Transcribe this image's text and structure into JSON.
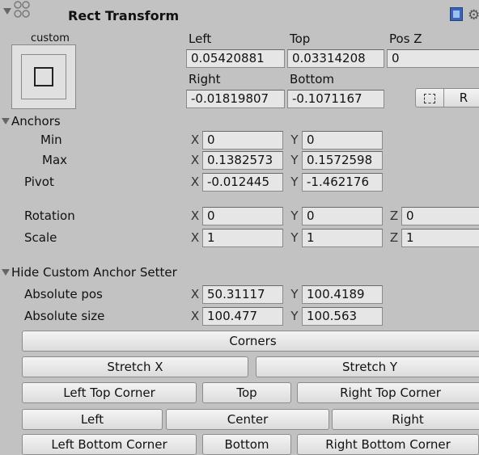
{
  "header": {
    "title": "Rect Transform"
  },
  "anchor_preset": {
    "top_label": "custom",
    "side_label": "custom"
  },
  "labels": {
    "left": "Left",
    "top": "Top",
    "pos_z": "Pos Z",
    "right": "Right",
    "bottom": "Bottom",
    "anchors": "Anchors",
    "min": "Min",
    "max": "Max",
    "pivot": "Pivot",
    "rotation": "Rotation",
    "scale": "Scale",
    "hide_custom": "Hide Custom Anchor Setter",
    "absolute_pos": "Absolute pos",
    "absolute_size": "Absolute size",
    "x": "X",
    "y": "Y",
    "z": "Z",
    "r_button": "R"
  },
  "values": {
    "left": "0.05420881",
    "top": "0.03314208",
    "pos_z": "0",
    "right": "-0.01819807",
    "bottom": "-0.1071167",
    "anchor_min_x": "0",
    "anchor_min_y": "0",
    "anchor_max_x": "0.1382573",
    "anchor_max_y": "0.1572598",
    "pivot_x": "-0.012445",
    "pivot_y": "-1.462176",
    "rotation_x": "0",
    "rotation_y": "0",
    "rotation_z": "0",
    "scale_x": "1",
    "scale_y": "1",
    "scale_z": "1",
    "abs_pos_x": "50.31117",
    "abs_pos_y": "100.4189",
    "abs_size_x": "100.477",
    "abs_size_y": "100.563"
  },
  "buttons": {
    "corners": "Corners",
    "stretch_x": "Stretch X",
    "stretch_y": "Stretch Y",
    "left_top_corner": "Left Top Corner",
    "top": "Top",
    "right_top_corner": "Right Top Corner",
    "left": "Left",
    "center": "Center",
    "right": "Right",
    "left_bottom_corner": "Left Bottom Corner",
    "bottom": "Bottom",
    "right_bottom_corner": "Right Bottom Corner"
  }
}
